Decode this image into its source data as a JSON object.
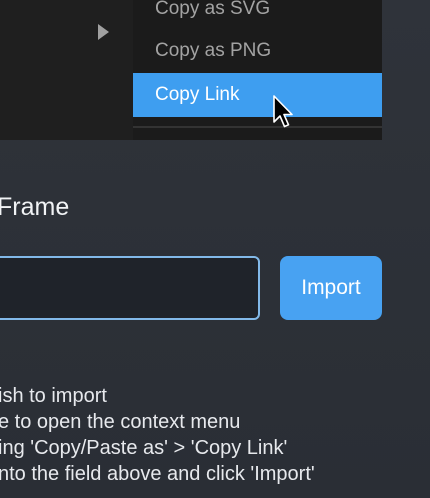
{
  "context_menu": {
    "items": [
      {
        "label": "Copy as SVG",
        "active": false
      },
      {
        "label": "Copy as PNG",
        "active": false
      },
      {
        "label": "Copy Link",
        "active": true
      }
    ]
  },
  "form": {
    "title": "Frame",
    "input_value": "",
    "import_label": "Import"
  },
  "instructions": [
    "ish to import",
    "e to open the context menu",
    "ing 'Copy/Paste as' > 'Copy Link'",
    "nto the field above and click 'Import'"
  ],
  "colors": {
    "accent": "#48a2f2",
    "menu_active": "#3e9ef0",
    "background": "#2b2f36",
    "menu_background": "#1b1b1b"
  }
}
